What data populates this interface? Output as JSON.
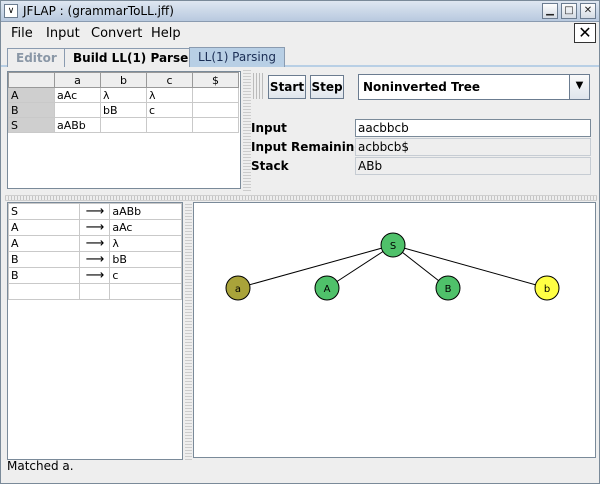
{
  "window": {
    "title": "JFLAP : (grammarToLL.jff)"
  },
  "menu": [
    "File",
    "Input",
    "Convert",
    "Help"
  ],
  "tabs": [
    "Editor",
    "Build LL(1) Parse",
    "LL(1) Parsing"
  ],
  "parse_table": {
    "columns": [
      "",
      "a",
      "b",
      "c",
      "$"
    ],
    "rows": [
      [
        "A",
        "aAc",
        "λ",
        "λ",
        ""
      ],
      [
        "B",
        "",
        "bB",
        "c",
        ""
      ],
      [
        "S",
        "aABb",
        "",
        "",
        ""
      ]
    ]
  },
  "controls": {
    "start_label": "Start",
    "step_label": "Step",
    "view_select": "Noninverted Tree",
    "input_label": "Input",
    "input_value": "aacbbcb",
    "remaining_label": "Input Remaining",
    "remaining_value": "acbbcb$",
    "stack_label": "Stack",
    "stack_value": "ABb"
  },
  "grammar": [
    {
      "lhs": "S",
      "rhs": "aABb"
    },
    {
      "lhs": "A",
      "rhs": "aAc"
    },
    {
      "lhs": "A",
      "rhs": "λ"
    },
    {
      "lhs": "B",
      "rhs": "bB"
    },
    {
      "lhs": "B",
      "rhs": "c"
    },
    {
      "lhs": "",
      "rhs": ""
    }
  ],
  "tree": {
    "root": {
      "label": "S",
      "color": "#4fc16a"
    },
    "children": [
      {
        "label": "a",
        "color": "#a9a33a"
      },
      {
        "label": "A",
        "color": "#4fc16a"
      },
      {
        "label": "B",
        "color": "#4fc16a"
      },
      {
        "label": "b",
        "color": "#ffff44"
      }
    ]
  },
  "status": "Matched a."
}
